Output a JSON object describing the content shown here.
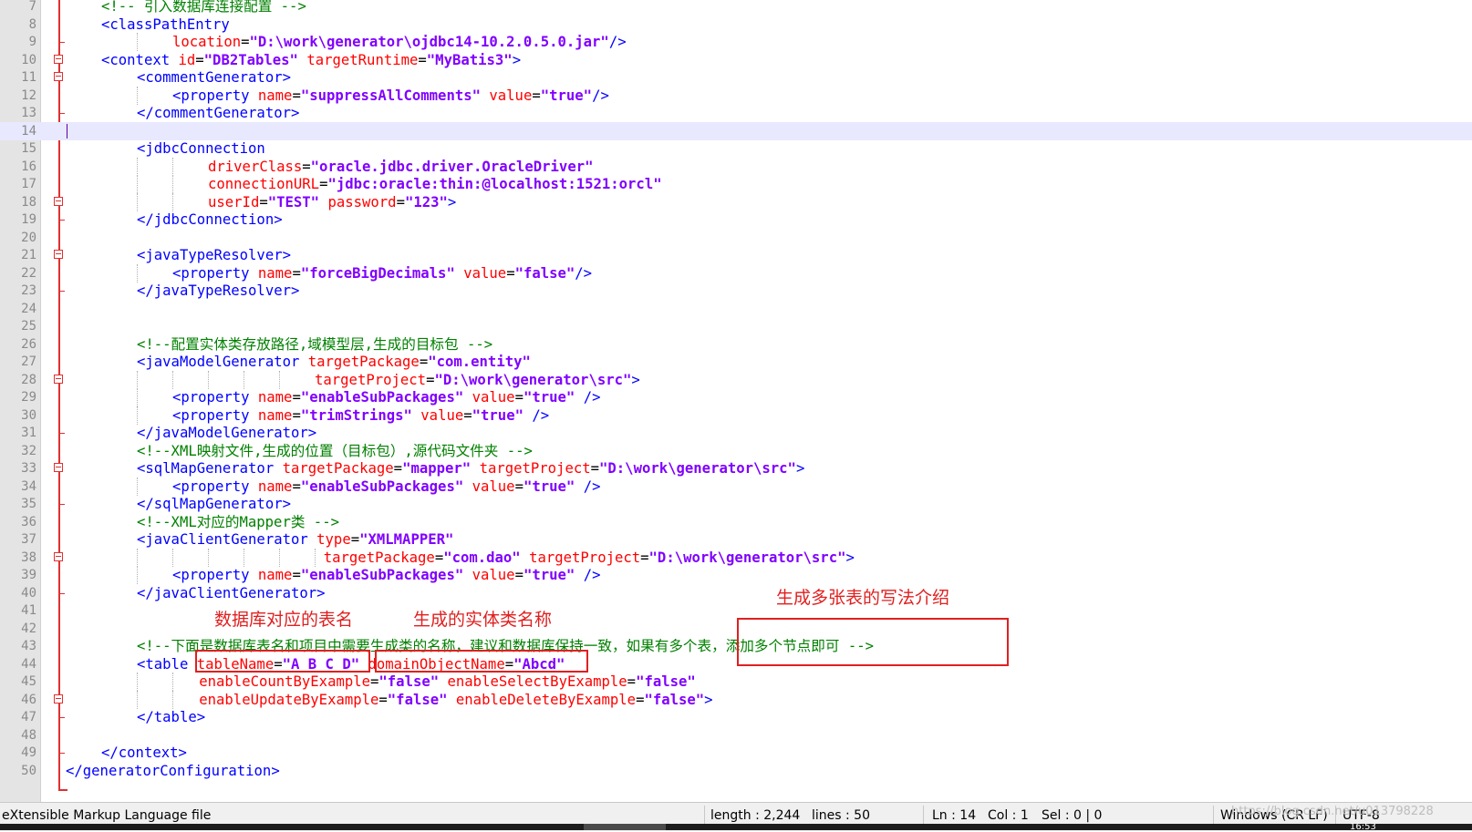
{
  "colors": {
    "tag": "#0000ff",
    "attribute": "#ff0000",
    "value": "#8000ff",
    "comment": "#008000",
    "annotation": "#e02020",
    "current_line": "#e8e8ff",
    "fold_marker": "#e03030"
  },
  "editor": {
    "current_line": 14,
    "lines": [
      {
        "n": "7",
        "indent": 4,
        "fold": "",
        "tokens": [
          {
            "k": "c",
            "s": "<!-- 引入数据库连接配置 -->"
          }
        ]
      },
      {
        "n": "8",
        "indent": 4,
        "fold": "",
        "tokens": [
          {
            "k": "t",
            "s": "<classPathEntry"
          }
        ]
      },
      {
        "n": "9",
        "indent": 12,
        "fold": "tick",
        "tokens": [
          {
            "k": "a",
            "s": "location"
          },
          {
            "k": "p",
            "s": "="
          },
          {
            "k": "v",
            "s": "\"D:\\work\\generator\\ojdbc14-10.2.0.5.0.jar\""
          },
          {
            "k": "t",
            "s": "/>"
          }
        ]
      },
      {
        "n": "10",
        "indent": 4,
        "fold": "box",
        "tokens": [
          {
            "k": "t",
            "s": "<context "
          },
          {
            "k": "a",
            "s": "id"
          },
          {
            "k": "p",
            "s": "="
          },
          {
            "k": "v",
            "s": "\"DB2Tables\""
          },
          {
            "k": "p",
            "s": " "
          },
          {
            "k": "a",
            "s": "targetRuntime"
          },
          {
            "k": "p",
            "s": "="
          },
          {
            "k": "v",
            "s": "\"MyBatis3\""
          },
          {
            "k": "t",
            "s": ">"
          }
        ]
      },
      {
        "n": "11",
        "indent": 8,
        "fold": "box",
        "tokens": [
          {
            "k": "t",
            "s": "<commentGenerator>"
          }
        ]
      },
      {
        "n": "12",
        "indent": 12,
        "fold": "",
        "tokens": [
          {
            "k": "t",
            "s": "<property "
          },
          {
            "k": "a",
            "s": "name"
          },
          {
            "k": "p",
            "s": "="
          },
          {
            "k": "v",
            "s": "\"suppressAllComments\""
          },
          {
            "k": "p",
            "s": " "
          },
          {
            "k": "a",
            "s": "value"
          },
          {
            "k": "p",
            "s": "="
          },
          {
            "k": "v",
            "s": "\"true\""
          },
          {
            "k": "t",
            "s": "/>"
          }
        ]
      },
      {
        "n": "13",
        "indent": 8,
        "fold": "tick",
        "tokens": [
          {
            "k": "t",
            "s": "</commentGenerator>"
          }
        ]
      },
      {
        "n": "14",
        "indent": 0,
        "fold": "",
        "tokens": []
      },
      {
        "n": "15",
        "indent": 8,
        "fold": "",
        "tokens": [
          {
            "k": "t",
            "s": "<jdbcConnection"
          }
        ]
      },
      {
        "n": "16",
        "indent": 16,
        "fold": "",
        "tokens": [
          {
            "k": "a",
            "s": "driverClass"
          },
          {
            "k": "p",
            "s": "="
          },
          {
            "k": "v",
            "s": "\"oracle.jdbc.driver.OracleDriver\""
          }
        ]
      },
      {
        "n": "17",
        "indent": 16,
        "fold": "",
        "tokens": [
          {
            "k": "a",
            "s": "connectionURL"
          },
          {
            "k": "p",
            "s": "="
          },
          {
            "k": "v",
            "s": "\"jdbc:oracle:thin:@localhost:1521:orcl\""
          }
        ]
      },
      {
        "n": "18",
        "indent": 16,
        "fold": "box",
        "tokens": [
          {
            "k": "a",
            "s": "userId"
          },
          {
            "k": "p",
            "s": "="
          },
          {
            "k": "v",
            "s": "\"TEST\""
          },
          {
            "k": "p",
            "s": " "
          },
          {
            "k": "a",
            "s": "password"
          },
          {
            "k": "p",
            "s": "="
          },
          {
            "k": "v",
            "s": "\"123\""
          },
          {
            "k": "t",
            "s": ">"
          }
        ]
      },
      {
        "n": "19",
        "indent": 8,
        "fold": "tick",
        "tokens": [
          {
            "k": "t",
            "s": "</jdbcConnection>"
          }
        ]
      },
      {
        "n": "20",
        "indent": 0,
        "fold": "",
        "tokens": []
      },
      {
        "n": "21",
        "indent": 8,
        "fold": "box",
        "tokens": [
          {
            "k": "t",
            "s": "<javaTypeResolver>"
          }
        ]
      },
      {
        "n": "22",
        "indent": 12,
        "fold": "",
        "tokens": [
          {
            "k": "t",
            "s": "<property "
          },
          {
            "k": "a",
            "s": "name"
          },
          {
            "k": "p",
            "s": "="
          },
          {
            "k": "v",
            "s": "\"forceBigDecimals\""
          },
          {
            "k": "p",
            "s": " "
          },
          {
            "k": "a",
            "s": "value"
          },
          {
            "k": "p",
            "s": "="
          },
          {
            "k": "v",
            "s": "\"false\""
          },
          {
            "k": "t",
            "s": "/>"
          }
        ]
      },
      {
        "n": "23",
        "indent": 8,
        "fold": "tick",
        "tokens": [
          {
            "k": "t",
            "s": "</javaTypeResolver>"
          }
        ]
      },
      {
        "n": "24",
        "indent": 0,
        "fold": "",
        "tokens": []
      },
      {
        "n": "25",
        "indent": 0,
        "fold": "",
        "tokens": []
      },
      {
        "n": "26",
        "indent": 8,
        "fold": "",
        "tokens": [
          {
            "k": "c",
            "s": "<!--配置实体类存放路径,域模型层,生成的目标包 -->"
          }
        ]
      },
      {
        "n": "27",
        "indent": 8,
        "fold": "",
        "tokens": [
          {
            "k": "t",
            "s": "<javaModelGenerator "
          },
          {
            "k": "a",
            "s": "targetPackage"
          },
          {
            "k": "p",
            "s": "="
          },
          {
            "k": "v",
            "s": "\"com.entity\""
          }
        ]
      },
      {
        "n": "28",
        "indent": 28,
        "fold": "box",
        "tokens": [
          {
            "k": "a",
            "s": "targetProject"
          },
          {
            "k": "p",
            "s": "="
          },
          {
            "k": "v",
            "s": "\"D:\\work\\generator\\src\""
          },
          {
            "k": "t",
            "s": ">"
          }
        ]
      },
      {
        "n": "29",
        "indent": 12,
        "fold": "",
        "tokens": [
          {
            "k": "t",
            "s": "<property "
          },
          {
            "k": "a",
            "s": "name"
          },
          {
            "k": "p",
            "s": "="
          },
          {
            "k": "v",
            "s": "\"enableSubPackages\""
          },
          {
            "k": "p",
            "s": " "
          },
          {
            "k": "a",
            "s": "value"
          },
          {
            "k": "p",
            "s": "="
          },
          {
            "k": "v",
            "s": "\"true\""
          },
          {
            "k": "p",
            "s": " "
          },
          {
            "k": "t",
            "s": "/>"
          }
        ]
      },
      {
        "n": "30",
        "indent": 12,
        "fold": "",
        "tokens": [
          {
            "k": "t",
            "s": "<property "
          },
          {
            "k": "a",
            "s": "name"
          },
          {
            "k": "p",
            "s": "="
          },
          {
            "k": "v",
            "s": "\"trimStrings\""
          },
          {
            "k": "p",
            "s": " "
          },
          {
            "k": "a",
            "s": "value"
          },
          {
            "k": "p",
            "s": "="
          },
          {
            "k": "v",
            "s": "\"true\""
          },
          {
            "k": "p",
            "s": " "
          },
          {
            "k": "t",
            "s": "/>"
          }
        ]
      },
      {
        "n": "31",
        "indent": 8,
        "fold": "tick",
        "tokens": [
          {
            "k": "t",
            "s": "</javaModelGenerator>"
          }
        ]
      },
      {
        "n": "32",
        "indent": 8,
        "fold": "",
        "tokens": [
          {
            "k": "c",
            "s": "<!--XML映射文件,生成的位置（目标包）,源代码文件夹 -->"
          }
        ]
      },
      {
        "n": "33",
        "indent": 8,
        "fold": "box",
        "tokens": [
          {
            "k": "t",
            "s": "<sqlMapGenerator "
          },
          {
            "k": "a",
            "s": "targetPackage"
          },
          {
            "k": "p",
            "s": "="
          },
          {
            "k": "v",
            "s": "\"mapper\""
          },
          {
            "k": "p",
            "s": " "
          },
          {
            "k": "a",
            "s": "targetProject"
          },
          {
            "k": "p",
            "s": "="
          },
          {
            "k": "v",
            "s": "\"D:\\work\\generator\\src\""
          },
          {
            "k": "t",
            "s": ">"
          }
        ]
      },
      {
        "n": "34",
        "indent": 12,
        "fold": "",
        "tokens": [
          {
            "k": "t",
            "s": "<property "
          },
          {
            "k": "a",
            "s": "name"
          },
          {
            "k": "p",
            "s": "="
          },
          {
            "k": "v",
            "s": "\"enableSubPackages\""
          },
          {
            "k": "p",
            "s": " "
          },
          {
            "k": "a",
            "s": "value"
          },
          {
            "k": "p",
            "s": "="
          },
          {
            "k": "v",
            "s": "\"true\""
          },
          {
            "k": "p",
            "s": " "
          },
          {
            "k": "t",
            "s": "/>"
          }
        ]
      },
      {
        "n": "35",
        "indent": 8,
        "fold": "tick",
        "tokens": [
          {
            "k": "t",
            "s": "</sqlMapGenerator>"
          }
        ]
      },
      {
        "n": "36",
        "indent": 8,
        "fold": "",
        "tokens": [
          {
            "k": "c",
            "s": "<!--XML对应的Mapper类 -->"
          }
        ]
      },
      {
        "n": "37",
        "indent": 8,
        "fold": "",
        "tokens": [
          {
            "k": "t",
            "s": "<javaClientGenerator "
          },
          {
            "k": "a",
            "s": "type"
          },
          {
            "k": "p",
            "s": "="
          },
          {
            "k": "v",
            "s": "\"XMLMAPPER\""
          }
        ]
      },
      {
        "n": "38",
        "indent": 29,
        "fold": "box",
        "tokens": [
          {
            "k": "a",
            "s": "targetPackage"
          },
          {
            "k": "p",
            "s": "="
          },
          {
            "k": "v",
            "s": "\"com.dao\""
          },
          {
            "k": "p",
            "s": " "
          },
          {
            "k": "a",
            "s": "targetProject"
          },
          {
            "k": "p",
            "s": "="
          },
          {
            "k": "v",
            "s": "\"D:\\work\\generator\\src\""
          },
          {
            "k": "t",
            "s": ">"
          }
        ]
      },
      {
        "n": "39",
        "indent": 12,
        "fold": "",
        "tokens": [
          {
            "k": "t",
            "s": "<property "
          },
          {
            "k": "a",
            "s": "name"
          },
          {
            "k": "p",
            "s": "="
          },
          {
            "k": "v",
            "s": "\"enableSubPackages\""
          },
          {
            "k": "p",
            "s": " "
          },
          {
            "k": "a",
            "s": "value"
          },
          {
            "k": "p",
            "s": "="
          },
          {
            "k": "v",
            "s": "\"true\""
          },
          {
            "k": "p",
            "s": " "
          },
          {
            "k": "t",
            "s": "/>"
          }
        ]
      },
      {
        "n": "40",
        "indent": 8,
        "fold": "tick",
        "tokens": [
          {
            "k": "t",
            "s": "</javaClientGenerator>"
          }
        ]
      },
      {
        "n": "41",
        "indent": 0,
        "fold": "",
        "tokens": []
      },
      {
        "n": "42",
        "indent": 0,
        "fold": "",
        "tokens": []
      },
      {
        "n": "43",
        "indent": 8,
        "fold": "",
        "tokens": [
          {
            "k": "c",
            "s": "<!--下面是数据库表名和项目中需要生成类的名称，建议和数据库保持一致，如果有多个表，添加多个节点即可 -->"
          }
        ]
      },
      {
        "n": "44",
        "indent": 8,
        "fold": "",
        "tokens": [
          {
            "k": "t",
            "s": "<table "
          },
          {
            "k": "a",
            "s": "tableName"
          },
          {
            "k": "p",
            "s": "="
          },
          {
            "k": "v",
            "s": "\"A_B_C_D\""
          },
          {
            "k": "p",
            "s": " "
          },
          {
            "k": "a",
            "s": "domainObjectName"
          },
          {
            "k": "p",
            "s": "="
          },
          {
            "k": "v",
            "s": "\"Abcd\""
          }
        ]
      },
      {
        "n": "45",
        "indent": 15,
        "fold": "",
        "tokens": [
          {
            "k": "a",
            "s": "enableCountByExample"
          },
          {
            "k": "p",
            "s": "="
          },
          {
            "k": "v",
            "s": "\"false\""
          },
          {
            "k": "p",
            "s": " "
          },
          {
            "k": "a",
            "s": "enableSelectByExample"
          },
          {
            "k": "p",
            "s": "="
          },
          {
            "k": "v",
            "s": "\"false\""
          }
        ]
      },
      {
        "n": "46",
        "indent": 15,
        "fold": "box",
        "tokens": [
          {
            "k": "a",
            "s": "enableUpdateByExample"
          },
          {
            "k": "p",
            "s": "="
          },
          {
            "k": "v",
            "s": "\"false\""
          },
          {
            "k": "p",
            "s": " "
          },
          {
            "k": "a",
            "s": "enableDeleteByExample"
          },
          {
            "k": "p",
            "s": "="
          },
          {
            "k": "v",
            "s": "\"false\""
          },
          {
            "k": "t",
            "s": ">"
          }
        ]
      },
      {
        "n": "47",
        "indent": 8,
        "fold": "tick",
        "tokens": [
          {
            "k": "t",
            "s": "</table>"
          }
        ]
      },
      {
        "n": "48",
        "indent": 0,
        "fold": "",
        "tokens": []
      },
      {
        "n": "49",
        "indent": 4,
        "fold": "tick",
        "tokens": [
          {
            "k": "t",
            "s": "</context>"
          }
        ]
      },
      {
        "n": "50",
        "indent": 0,
        "fold": "",
        "tokens": [
          {
            "k": "t",
            "s": "</generatorConfiguration>"
          }
        ]
      }
    ]
  },
  "annotations": {
    "table_name_label": "数据库对应的表名",
    "entity_name_label": "生成的实体类名称",
    "multi_table_label": "生成多张表的写法介绍"
  },
  "status_bar": {
    "file_type": "eXtensible Markup Language file",
    "length": "length : 2,244",
    "lines": "lines : 50",
    "ln": "Ln : 14",
    "col": "Col : 1",
    "sel": "Sel : 0 | 0",
    "eol": "Windows (CR LF)",
    "encoding": "UTF-8"
  },
  "watermark": "https://blog.csdn.net/u013798228",
  "taskbar": {
    "clock": "16:53"
  }
}
